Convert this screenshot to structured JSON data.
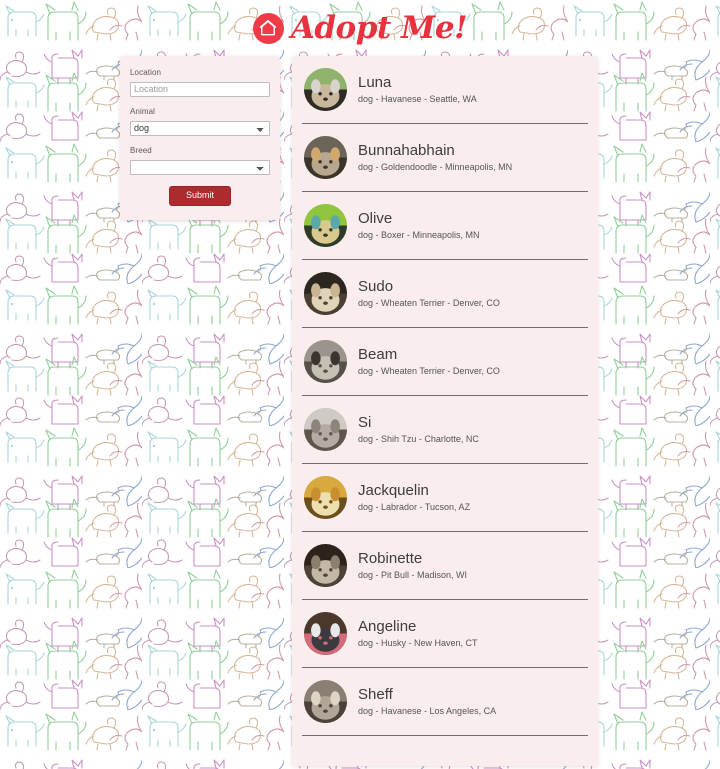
{
  "header": {
    "brand": "Adopt Me!",
    "logo_icon": "house-paw-logo-icon",
    "logo_color": "#ef3b48"
  },
  "search_form": {
    "location": {
      "label": "Location",
      "value": "",
      "placeholder": "Location"
    },
    "animal": {
      "label": "Animal",
      "selected": "dog",
      "options": [
        "dog"
      ]
    },
    "breed": {
      "label": "Breed",
      "selected": "",
      "options": [
        ""
      ]
    },
    "submit_label": "Submit",
    "submit_color": "#ad2b2f",
    "panel_color": "#faeded"
  },
  "results": {
    "panel_color": "#faeded",
    "pets": [
      {
        "name": "Luna",
        "description": "dog - Havanese - Seattle, WA",
        "animal": "dog",
        "breed": "Havanese",
        "city": "Seattle",
        "state": "WA",
        "photo_alt": "luna-photo",
        "photo_colors": [
          "#8fb36a",
          "#d8d4cd",
          "#c9b79c",
          "#2e2a26"
        ]
      },
      {
        "name": "Bunnahabhain",
        "description": "dog - Goldendoodle - Minneapolis, MN",
        "animal": "dog",
        "breed": "Goldendoodle",
        "city": "Minneapolis",
        "state": "MN",
        "photo_alt": "bunnahabhain-photo",
        "photo_colors": [
          "#6b6459",
          "#d2a86f",
          "#b8a78e",
          "#3a342c"
        ]
      },
      {
        "name": "Olive",
        "description": "dog - Boxer - Minneapolis, MN",
        "animal": "dog",
        "breed": "Boxer",
        "city": "Minneapolis",
        "state": "MN",
        "photo_alt": "olive-photo",
        "photo_colors": [
          "#8fc63d",
          "#5aa8a8",
          "#d9c98f",
          "#2f3a2a"
        ]
      },
      {
        "name": "Sudo",
        "description": "dog - Wheaten Terrier - Denver, CO",
        "animal": "dog",
        "breed": "Wheaten Terrier",
        "city": "Denver",
        "state": "CO",
        "photo_alt": "sudo-photo",
        "photo_colors": [
          "#2b2620",
          "#cbb492",
          "#e0d3b8",
          "#4a3f32"
        ]
      },
      {
        "name": "Beam",
        "description": "dog - Wheaten Terrier - Denver, CO",
        "animal": "dog",
        "breed": "Wheaten Terrier",
        "city": "Denver",
        "state": "CO",
        "photo_alt": "beam-photo",
        "photo_colors": [
          "#9a948c",
          "#3a342e",
          "#c6bfb4",
          "#55504a"
        ]
      },
      {
        "name": "Si",
        "description": "dog - Shih Tzu - Charlotte, NC",
        "animal": "dog",
        "breed": "Shih Tzu",
        "city": "Charlotte",
        "state": "NC",
        "photo_alt": "si-photo",
        "photo_colors": [
          "#cfcac6",
          "#8d857c",
          "#b4aca2",
          "#5e564d"
        ]
      },
      {
        "name": "Jackquelin",
        "description": "dog - Labrador - Tucson, AZ",
        "animal": "dog",
        "breed": "Labrador",
        "city": "Tucson",
        "state": "AZ",
        "photo_alt": "jackquelin-photo",
        "photo_colors": [
          "#d8a93c",
          "#c98f2e",
          "#eedfae",
          "#6b4f1c"
        ]
      },
      {
        "name": "Robinette",
        "description": "dog - Pit Bull - Madison, WI",
        "animal": "dog",
        "breed": "Pit Bull",
        "city": "Madison",
        "state": "WI",
        "photo_alt": "robinette-photo",
        "photo_colors": [
          "#2c241c",
          "#8d7f6e",
          "#c3b8a6",
          "#4d4236"
        ]
      },
      {
        "name": "Angeline",
        "description": "dog - Husky - New Haven, CT",
        "animal": "dog",
        "breed": "Husky",
        "city": "New Haven",
        "state": "CT",
        "photo_alt": "angeline-photo",
        "photo_colors": [
          "#4a382a",
          "#e8e8ea",
          "#3b3b3f",
          "#d46a7a"
        ]
      },
      {
        "name": "Sheff",
        "description": "dog - Havanese - Los Angeles, CA",
        "animal": "dog",
        "breed": "Havanese",
        "city": "Los Angeles",
        "state": "CA",
        "photo_alt": "sheff-photo",
        "photo_colors": [
          "#8a7f72",
          "#ddd5c6",
          "#b0a596",
          "#4a4239"
        ]
      }
    ]
  }
}
